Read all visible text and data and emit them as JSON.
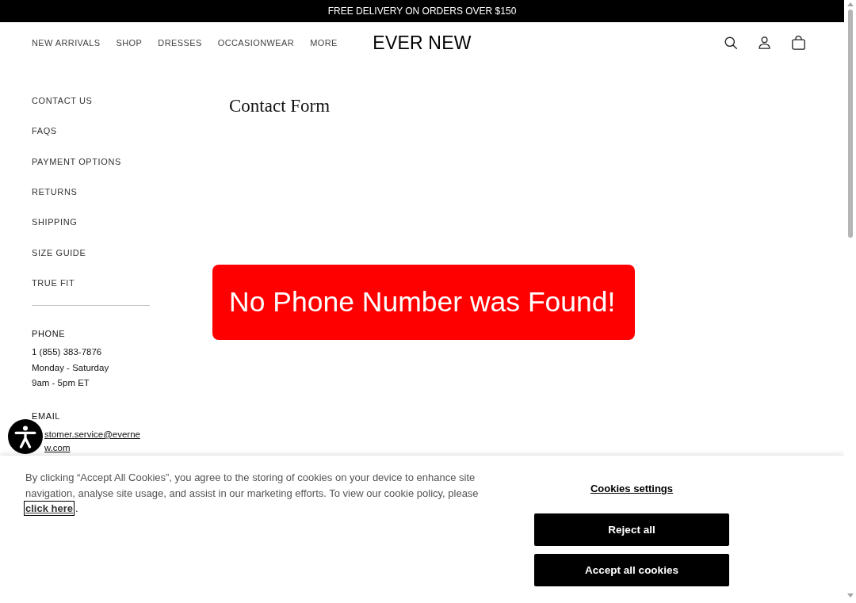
{
  "announcement_bar": {
    "text": "FREE DELIVERY ON ORDERS OVER $150"
  },
  "header": {
    "nav": [
      "NEW ARRIVALS",
      "SHOP",
      "DRESSES",
      "OCCASIONWEAR",
      "MORE"
    ],
    "logo": "EVER NEW"
  },
  "sidebar": {
    "links": [
      "CONTACT US",
      "FAQS",
      "PAYMENT OPTIONS",
      "RETURNS",
      "SHIPPING",
      "SIZE GUIDE",
      "TRUE FIT"
    ],
    "phone": {
      "label": "PHONE",
      "lines": [
        "1 (855) 383-7876",
        "Monday - Saturday",
        "9am - 5pm ET"
      ]
    },
    "email": {
      "label": "EMAIL",
      "address": "stomer.service@evernew.com"
    }
  },
  "main": {
    "title": "Contact Form",
    "alert": "No Phone Number was Found!"
  },
  "cookie_banner": {
    "message": "By clicking “Accept All Cookies”, you agree to the storing of cookies on your device to enhance site navigation, analyse site usage, and assist in our marketing efforts. To view our cookie policy, please",
    "policy_link": {
      "text": "click here",
      "focused": true
    },
    "message_end": ".",
    "settings_link": "Cookies settings",
    "buttons": [
      "Reject all",
      "Accept all cookies"
    ]
  }
}
